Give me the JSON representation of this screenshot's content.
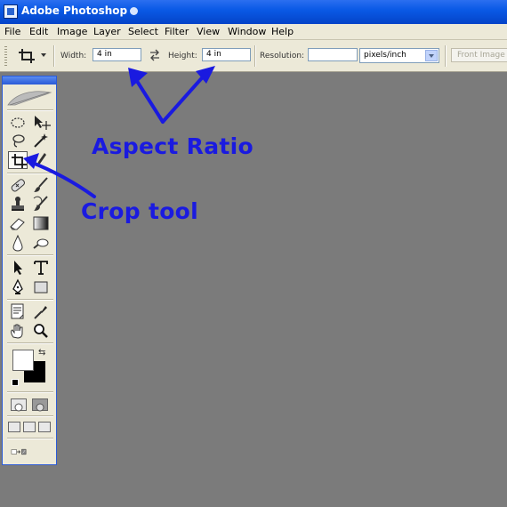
{
  "window": {
    "title": "Adobe Photoshop"
  },
  "menubar": {
    "items": [
      "File",
      "Edit",
      "Image",
      "Layer",
      "Select",
      "Filter",
      "View",
      "Window",
      "Help"
    ]
  },
  "options": {
    "width_label": "Width:",
    "width_value": "4 in",
    "height_label": "Height:",
    "height_value": "4 in",
    "resolution_label": "Resolution:",
    "resolution_value": "",
    "resolution_unit": "pixels/inch",
    "front_image_label": "Front Image"
  },
  "toolbox": {
    "tools": [
      "rectangular-marquee",
      "move",
      "lasso",
      "magic-wand",
      "crop",
      "slice",
      "healing-brush",
      "brush",
      "clone-stamp",
      "history-brush",
      "eraser",
      "gradient",
      "blur",
      "dodge",
      "path-selection",
      "type",
      "pen",
      "shape",
      "notes",
      "eyedropper",
      "hand",
      "zoom"
    ],
    "active_tool": "crop",
    "foreground_color": "#ffffff",
    "background_color": "#000000"
  },
  "annotations": {
    "aspect_ratio": "Aspect Ratio",
    "crop_tool": "Crop tool",
    "color": "#1a1ae0"
  },
  "colors": {
    "canvas": "#7b7b7b",
    "titlebar": "#0a5ae6",
    "chrome": "#ece9d8"
  }
}
